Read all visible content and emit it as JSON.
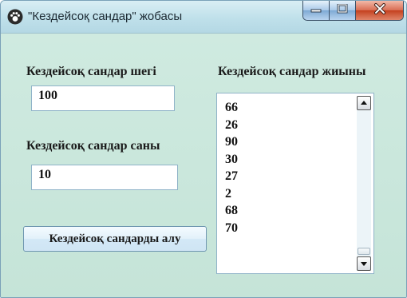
{
  "window": {
    "title": "\"Кездейсоқ сандар\" жобасы"
  },
  "form": {
    "limit_label": "Кездейсоқ сандар шегі",
    "limit_value": "100",
    "count_label": "Кездейсоқ сандар саны",
    "count_value": "10",
    "get_button": "Кездейсоқ сандарды алу",
    "set_label": "Кездейсоқ сандар жиыны",
    "set_items": [
      "66",
      "26",
      "90",
      "30",
      "27",
      "2",
      "68",
      "70"
    ]
  },
  "icons": {
    "app": "paw-icon",
    "minimize": "minimize-icon",
    "maximize": "maximize-icon",
    "close": "close-icon",
    "scroll_up": "scroll-up-arrow-icon",
    "scroll_down": "scroll-down-arrow-icon"
  },
  "colors": {
    "client_background": "#c9e6dc",
    "close_button": "#c4411f"
  }
}
